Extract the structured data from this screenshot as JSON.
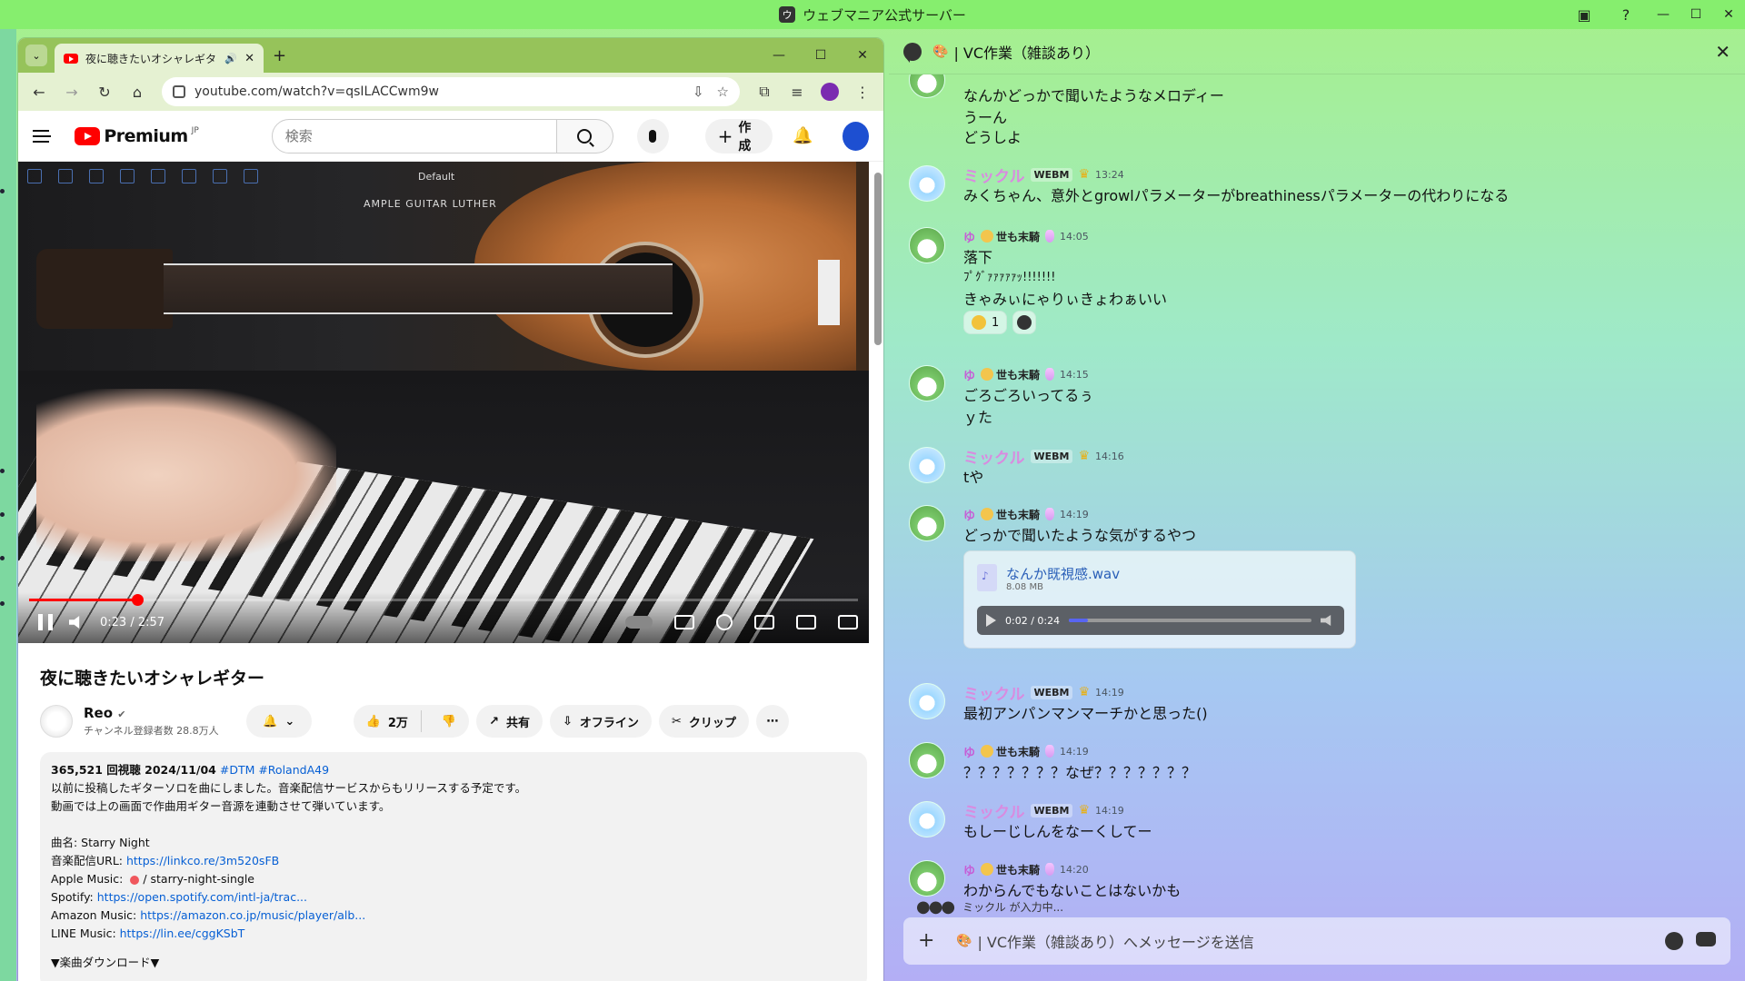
{
  "discord": {
    "window_title": "ウェブマニア公式サーバー",
    "channel_name": "| VC作業（雑談あり）",
    "composer_placeholder": "| VC作業（雑談あり）へメッセージを送信",
    "typing_indicator": "ミックル が入力中..."
  },
  "messages": [
    {
      "author": "",
      "lines": [
        "なんかどっかで聞いたようなメロディー",
        "うーん",
        "どうしよ"
      ]
    },
    {
      "author": "ミックル",
      "role": "WEBM",
      "time": "13:24",
      "lines": [
        "みくちゃん、意外とgrowlパラメーターがbreathinessパラメーターの代わりになる"
      ]
    },
    {
      "author": "世も末騎",
      "prefix": "ゆ",
      "time": "14:05",
      "lines": [
        "落下",
        "ﾌﾟｸﾞｧｧｧｧｧｯ!!!!!!!",
        "きゃみぃにゃりぃきょわぁいい"
      ],
      "reaction_count": "1"
    },
    {
      "author": "世も末騎",
      "prefix": "ゆ",
      "time": "14:15",
      "lines": [
        "ごろごろいってるぅ",
        "ｙた"
      ]
    },
    {
      "author": "ミックル",
      "role": "WEBM",
      "time": "14:16",
      "lines": [
        "tや"
      ]
    },
    {
      "author": "世も末騎",
      "prefix": "ゆ",
      "time": "14:19",
      "lines": [
        "どっかで聞いたような気がするやつ"
      ],
      "attachment": {
        "filename": "なんか既視感.wav",
        "size": "8.08 MB",
        "time": "0:02 / 0:24",
        "progress": 0.08
      }
    },
    {
      "author": "ミックル",
      "role": "WEBM",
      "time": "14:19",
      "lines": [
        "最初アンパンマンマーチかと思った()"
      ]
    },
    {
      "author": "世も末騎",
      "prefix": "ゆ",
      "time": "14:19",
      "lines": [
        "？？？？？？？なぜ？？？？？？？"
      ]
    },
    {
      "author": "ミックル",
      "role": "WEBM",
      "time": "14:19",
      "lines": [
        "もしーじしんをなーくしてー"
      ]
    },
    {
      "author": "世も末騎",
      "prefix": "ゆ",
      "time": "14:20",
      "lines": [
        "わからんでもないことはないかも"
      ]
    }
  ],
  "browser": {
    "tab_title": "夜に聴きたいオシャレギター - Yo",
    "url": "youtube.com/watch?v=qsILACCwm9w"
  },
  "youtube": {
    "logo_text": "Premium",
    "logo_region": "JP",
    "search_placeholder": "検索",
    "create_label": "作成",
    "plugin_preset": "Default",
    "plugin_brand": "AMPLE GUITAR LUTHER",
    "time_display": "0:23 / 2:57",
    "progress": 0.13,
    "video_title": "夜に聴きたいオシャレギター",
    "channel_name": "Reo",
    "subscribers": "チャンネル登録者数 28.8万人",
    "likes": "2万",
    "share_label": "共有",
    "offline_label": "オフライン",
    "clip_label": "クリップ",
    "desc_stats": "365,521 回視聴  2024/11/04",
    "desc_tags": "#DTM #RolandA49",
    "desc_line1": "以前に投稿したギターソロを曲にしました。音楽配信サービスからもリリースする予定です。",
    "desc_line2": "動画では上の画面で作曲用ギター音源を連動させて弾いています。",
    "song_name": "曲名: Starry Night",
    "music_url_label": "音楽配信URL: ",
    "music_url": "https://linkco.re/3m520sFB",
    "apple_label": "Apple Music: ",
    "apple_value": "/ starry-night-single",
    "spotify_label": "Spotify: ",
    "spotify_url": "https://open.spotify.com/intl-ja/trac...",
    "amazon_label": "Amazon Music: ",
    "amazon_url": "https://amazon.co.jp/music/player/alb...",
    "line_label": "LINE Music: ",
    "line_url": "https://lin.ee/cggKSbT",
    "download_heading": "▼楽曲ダウンロード▼"
  }
}
